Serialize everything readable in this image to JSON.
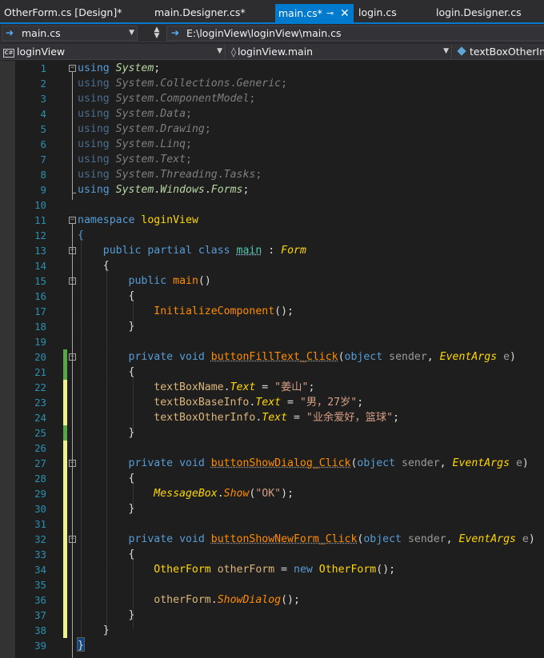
{
  "tabs": [
    {
      "label": "OtherForm.cs [Design]*",
      "active": false
    },
    {
      "label": "main.Designer.cs*",
      "active": false
    },
    {
      "label": "main.cs*",
      "active": true
    },
    {
      "label": "login.cs",
      "active": false
    },
    {
      "label": "login.Designer.cs",
      "active": false
    }
  ],
  "tab_icons": {
    "pin": "pin-icon",
    "close": "close-icon"
  },
  "navbar": {
    "file_combo": "main.cs",
    "path_combo": "E:\\loginView\\loginView\\main.cs"
  },
  "memberbar": {
    "project_combo": "loginView",
    "project_icon": "csharp-project-icon",
    "type_combo": "loginView.main",
    "member_combo": "textBoxOtherInfo"
  },
  "editor": {
    "line_numbers": [
      "1",
      "2",
      "3",
      "4",
      "5",
      "6",
      "7",
      "8",
      "9",
      "10",
      "11",
      "12",
      "13",
      "14",
      "15",
      "16",
      "17",
      "18",
      "19",
      "20",
      "21",
      "22",
      "23",
      "24",
      "25",
      "26",
      "27",
      "28",
      "29",
      "30",
      "31",
      "32",
      "33",
      "34",
      "35",
      "36",
      "37",
      "38",
      "39"
    ],
    "usings": [
      {
        "kw": "using",
        "ns": "System",
        "end": ";"
      },
      {
        "kw": "using",
        "ns": "System",
        "rest": [
          ".",
          "Collections",
          ".",
          "Generic"
        ],
        "end": ";"
      },
      {
        "kw": "using",
        "ns": "System",
        "rest": [
          ".",
          "ComponentModel"
        ],
        "end": ";"
      },
      {
        "kw": "using",
        "ns": "System",
        "rest": [
          ".",
          "Data"
        ],
        "end": ";"
      },
      {
        "kw": "using",
        "ns": "System",
        "rest": [
          ".",
          "Drawing"
        ],
        "end": ";"
      },
      {
        "kw": "using",
        "ns": "System",
        "rest": [
          ".",
          "Linq"
        ],
        "end": ";"
      },
      {
        "kw": "using",
        "ns": "System",
        "rest": [
          ".",
          "Text"
        ],
        "end": ";"
      },
      {
        "kw": "using",
        "ns": "System",
        "rest": [
          ".",
          "Threading",
          ".",
          "Tasks"
        ],
        "end": ";"
      },
      {
        "kw": "using",
        "ns": "System",
        "rest": [
          ".",
          "Windows",
          ".",
          "Forms"
        ],
        "end": ";"
      }
    ],
    "tokens": {
      "kw_namespace": "namespace",
      "namespace_name": "loginView",
      "open_brace": "{",
      "close_brace": "}",
      "kw_public": "public",
      "kw_partial": "partial",
      "kw_class": "class",
      "class_name": "main",
      "colon": ":",
      "base_class": "Form",
      "ctor_name": "main",
      "empty_parens": "()",
      "init_component": "InitializeComponent",
      "call_end": "();",
      "kw_private": "private",
      "kw_void": "void",
      "kw_object": "object",
      "param_sender": "sender",
      "comma": ",",
      "event_args": "EventArgs",
      "param_e": "e",
      "open_paren": "(",
      "close_paren": ")",
      "dot": ".",
      "assign": " = ",
      "semicolon": ";",
      "method_fill": "buttonFillText_Click",
      "tb_name": "textBoxName",
      "tb_base": "textBoxBaseInfo",
      "tb_other": "textBoxOtherInfo",
      "prop_text": "Text",
      "str_name": "\"姜山\"",
      "str_base": "\"男，27岁\"",
      "str_other": "\"业余爱好，篮球\"",
      "method_dialog": "buttonShowDialog_Click",
      "messagebox": "MessageBox",
      "show": "Show",
      "str_ok": "\"OK\"",
      "close_call": ");",
      "method_newform": "buttonShowNewForm_Click",
      "otherform_type": "OtherForm",
      "otherform_var": "otherForm",
      "kw_new": "new",
      "show_dialog": "ShowDialog"
    }
  },
  "colors": {
    "accent_tab": "#007acc",
    "line_number": "#2b91af",
    "saved_change": "#57a64a",
    "unsaved_change": "#efef91",
    "keyword": "#569cd6",
    "method": "#ff8c00",
    "string": "#d69d85"
  }
}
